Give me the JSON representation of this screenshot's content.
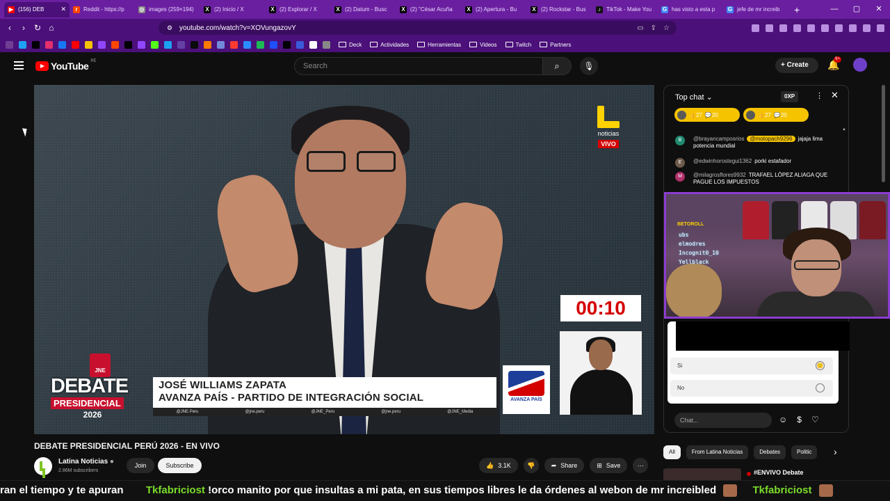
{
  "browser": {
    "tabs": [
      {
        "label": "(156) DEB",
        "active": true,
        "color": "#ff0000",
        "glyph": "▶"
      },
      {
        "label": "Reddit - https://p",
        "color": "#ff4500",
        "glyph": "r"
      },
      {
        "label": "images (259×194)",
        "color": "#888888",
        "glyph": "◎"
      },
      {
        "label": "(2) Inicio / X",
        "color": "#000000",
        "glyph": "X"
      },
      {
        "label": "(2) Explorar / X",
        "color": "#000000",
        "glyph": "X"
      },
      {
        "label": "(2) Datum - Busc",
        "color": "#000000",
        "glyph": "X"
      },
      {
        "label": "(2) \"César Acuña",
        "color": "#000000",
        "glyph": "X"
      },
      {
        "label": "(2) Apertura - Bu",
        "color": "#000000",
        "glyph": "X"
      },
      {
        "label": "(2) Rockstar - Bus",
        "color": "#000000",
        "glyph": "X"
      },
      {
        "label": "TikTok - Make You",
        "color": "#111111",
        "glyph": "♪"
      },
      {
        "label": "has visto a esta p",
        "color": "#4285f4",
        "glyph": "G"
      },
      {
        "label": "jefe de mr increib",
        "color": "#4285f4",
        "glyph": "G"
      }
    ],
    "url": "youtube.com/watch?v=XOVungazovY",
    "bookmarks": [
      {
        "label": "Deck"
      },
      {
        "label": "Actividades"
      },
      {
        "label": "Herramientas"
      },
      {
        "label": "Videos"
      },
      {
        "label": "Twitch"
      },
      {
        "label": "Partners"
      }
    ]
  },
  "youtube": {
    "logo_text": "YouTube",
    "region": "PE",
    "search_placeholder": "Search",
    "create_label": "Create",
    "notif_badge": "9+"
  },
  "video": {
    "channel_brand": "noticias",
    "live_label": "VIVO",
    "timer": "00:10",
    "jne_label": "JNE",
    "debate_line1": "DEBATE",
    "debate_line2": "PRESIDENCIAL",
    "debate_year": "2026",
    "speaker_name": "JOSÉ WILLIAMS ZAPATA",
    "speaker_party": "AVANZA PAÍS - PARTIDO DE INTEGRACIÓN SOCIAL",
    "socials": [
      "@JNE.Peru",
      "@jne.peru",
      "@JNE_Peru",
      "@jne.peru",
      "@JNE_Media"
    ],
    "party_logo_text": "AVANZA PAÍS",
    "title": "DEBATE PRESIDENCIAL PERÚ 2026 - EN VIVO",
    "channel_name": "Latina Noticias",
    "subscribers": "2.86M subscribers",
    "join_label": "Join",
    "subscribe_label": "Subscribe",
    "likes": "3.1K",
    "share_label": "Share",
    "save_label": "Save"
  },
  "chat": {
    "header": "Top chat",
    "xp": "0XP",
    "chips": [
      {
        "likes": "27",
        "comments": "20"
      },
      {
        "likes": "27",
        "comments": "20"
      }
    ],
    "messages": [
      {
        "initial": "B",
        "color": "#1f8a70",
        "author": "@brayancamposrios",
        "mention": "@motopach9296",
        "text": "jajaja lima potencia mundial"
      },
      {
        "initial": "E",
        "color": "#6d5a4a",
        "author": "@edwinhorostegui1362",
        "text": "porki estafador"
      },
      {
        "initial": "M",
        "color": "#b0306a",
        "author": "@milagrosflores9932",
        "text": "TRAFAEL LÓPEZ ALIAGA QUE PAGUE LOS IMPUESTOS"
      }
    ],
    "poll_options": [
      {
        "label": "Si",
        "icon": "🙂"
      },
      {
        "label": "No",
        "icon": ""
      }
    ],
    "input_placeholder": "Chat..."
  },
  "stream_overlay": {
    "brand": "BETOROLL",
    "subs": [
      "ubs",
      "elmodres",
      "Incognit0_10",
      "Yellblack"
    ]
  },
  "filters": [
    "All",
    "From Latina Noticias",
    "Debates",
    "Politic"
  ],
  "recommendation": {
    "title": "#ENVIVO Debate"
  },
  "ticker": {
    "lead": "ran el tiempo y te apuran",
    "user": "Tkfabriciost",
    "message": "!orco manito por que insultas a mi pata, en sus tiempos libres le da órdenes al webon de mr increibled"
  }
}
